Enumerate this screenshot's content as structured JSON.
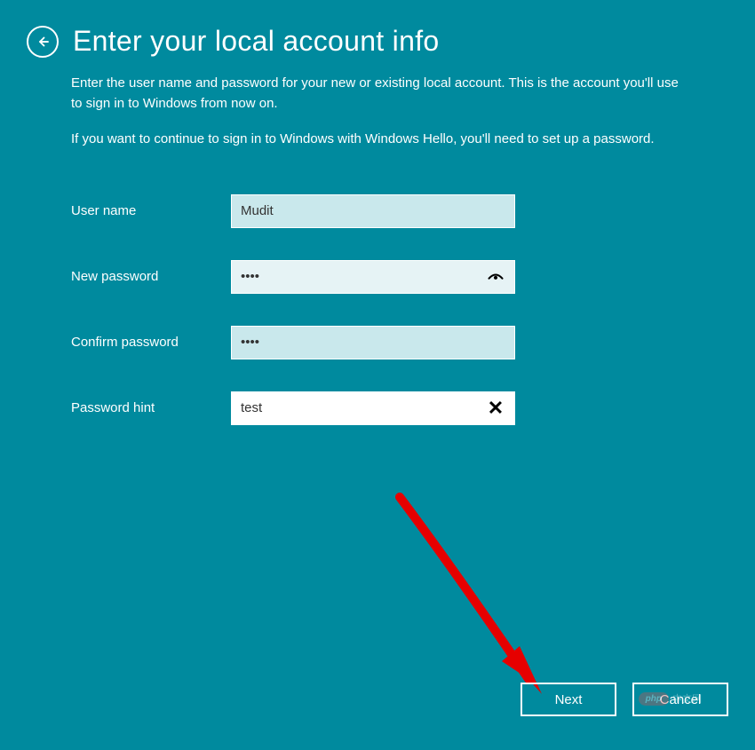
{
  "header": {
    "title": "Enter your local account info"
  },
  "description": {
    "p1": "Enter the user name and password for your new or existing local account. This is the account you'll use to sign in to Windows from now on.",
    "p2": "If you want to continue to sign in to Windows with Windows Hello, you'll need to set up a password."
  },
  "form": {
    "username_label": "User name",
    "username_value": "Mudit",
    "newpassword_label": "New password",
    "newpassword_value": "••••",
    "confirmpassword_label": "Confirm password",
    "confirmpassword_value": "••••",
    "hint_label": "Password hint",
    "hint_value": "test"
  },
  "footer": {
    "next_label": "Next",
    "cancel_label": "Cancel"
  },
  "watermark": {
    "badge": "php",
    "text": "中文网"
  },
  "colors": {
    "background": "#008a9e",
    "input_light": "#e6f3f5",
    "input_med": "#c9e8ec",
    "arrow": "#e60000"
  }
}
